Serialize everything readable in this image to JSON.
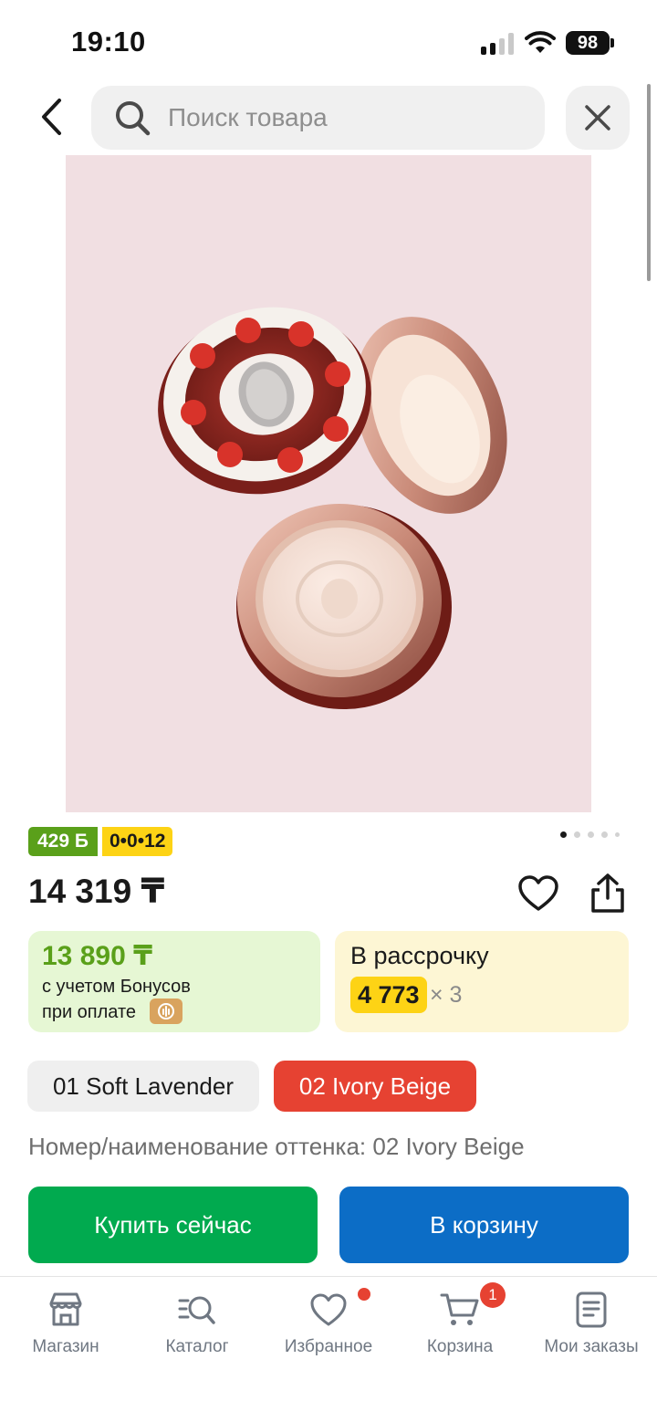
{
  "status_bar": {
    "time": "19:10",
    "battery": "98"
  },
  "search": {
    "placeholder": "Поиск товара"
  },
  "product": {
    "bonus_badge": "429 Б",
    "installment_badge": "0•0•12",
    "price": "14 319 ₸",
    "gallery_total": 5,
    "gallery_active": 1
  },
  "bonus_offer": {
    "price": "13 890 ₸",
    "line1": "с учетом Бонусов",
    "line2": "при оплате"
  },
  "credit_offer": {
    "title": "В рассрочку",
    "amount": "4 773",
    "multiplier": "× 3"
  },
  "variants": [
    {
      "label": "01 Soft Lavender",
      "selected": false
    },
    {
      "label": "02 Ivory Beige",
      "selected": true
    }
  ],
  "shade_line": "Номер/наименование оттенка: 02 Ivory Beige",
  "actions": {
    "buy_now": "Купить сейчас",
    "add_to_cart": "В корзину"
  },
  "tab_bar": {
    "items": [
      {
        "label": "Магазин",
        "icon": "store-icon"
      },
      {
        "label": "Каталог",
        "icon": "catalog-search-icon"
      },
      {
        "label": "Избранное",
        "icon": "heart-icon",
        "dot": true
      },
      {
        "label": "Корзина",
        "icon": "cart-icon",
        "badge": "1"
      },
      {
        "label": "Мои заказы",
        "icon": "orders-icon"
      }
    ]
  },
  "colors": {
    "bonus_green": "#5aa01a",
    "installment_yellow": "#fdd315",
    "selected_chip_red": "#e64232",
    "buy_green": "#01aa4f",
    "cart_blue": "#0c6dc6"
  }
}
